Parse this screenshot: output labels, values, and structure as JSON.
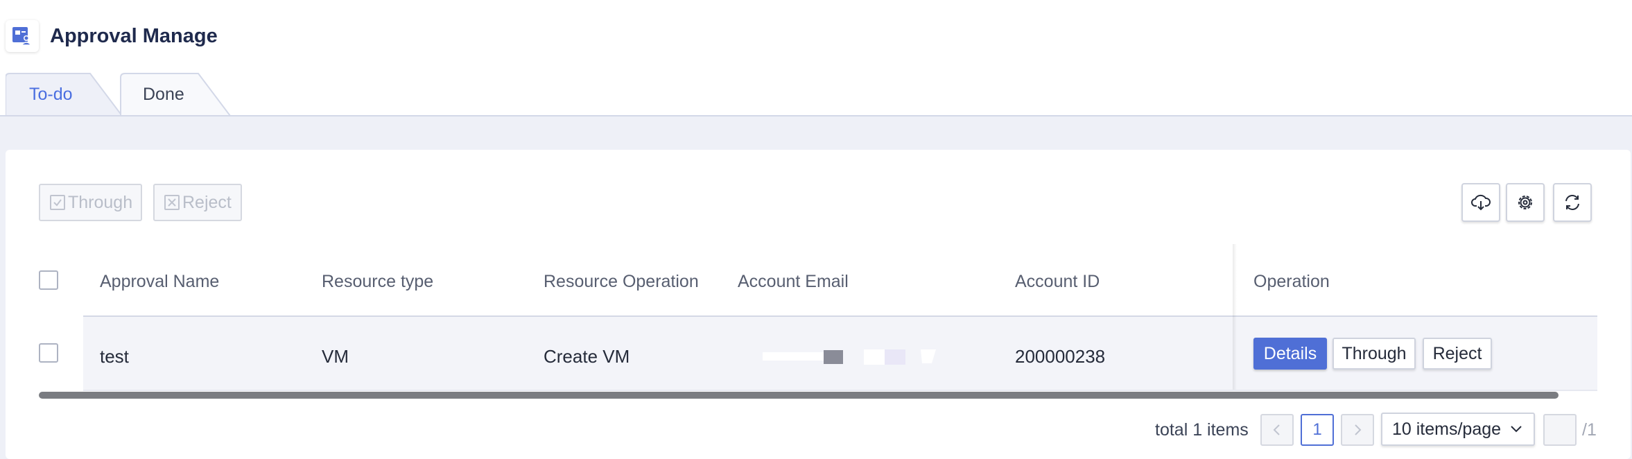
{
  "header": {
    "title": "Approval Manage",
    "logo_icon": "approval-app-icon"
  },
  "tabs": [
    {
      "label": "To-do",
      "active": true
    },
    {
      "label": "Done",
      "active": false
    }
  ],
  "toolbar": {
    "through_label": "Through",
    "reject_label": "Reject",
    "icons": [
      "cloud-download-icon",
      "settings-icon",
      "refresh-icon"
    ]
  },
  "table": {
    "columns": [
      "Approval Name",
      "Resource type",
      "Resource Operation",
      "Account Email",
      "Account ID",
      "Operation"
    ],
    "rows": [
      {
        "approval_name": "test",
        "resource_type": "VM",
        "resource_operation": "Create VM",
        "account_email": "",
        "account_id": "200000238",
        "actions": {
          "details": "Details",
          "through": "Through",
          "reject": "Reject"
        }
      }
    ]
  },
  "pagination": {
    "total_text": "total 1 items",
    "current_page": "1",
    "page_size": "10 items/page",
    "page_count_text": "/1"
  },
  "colors": {
    "accent": "#4f6fd6",
    "band": "#eef0f7",
    "scrollbar": "#7a7c81"
  }
}
